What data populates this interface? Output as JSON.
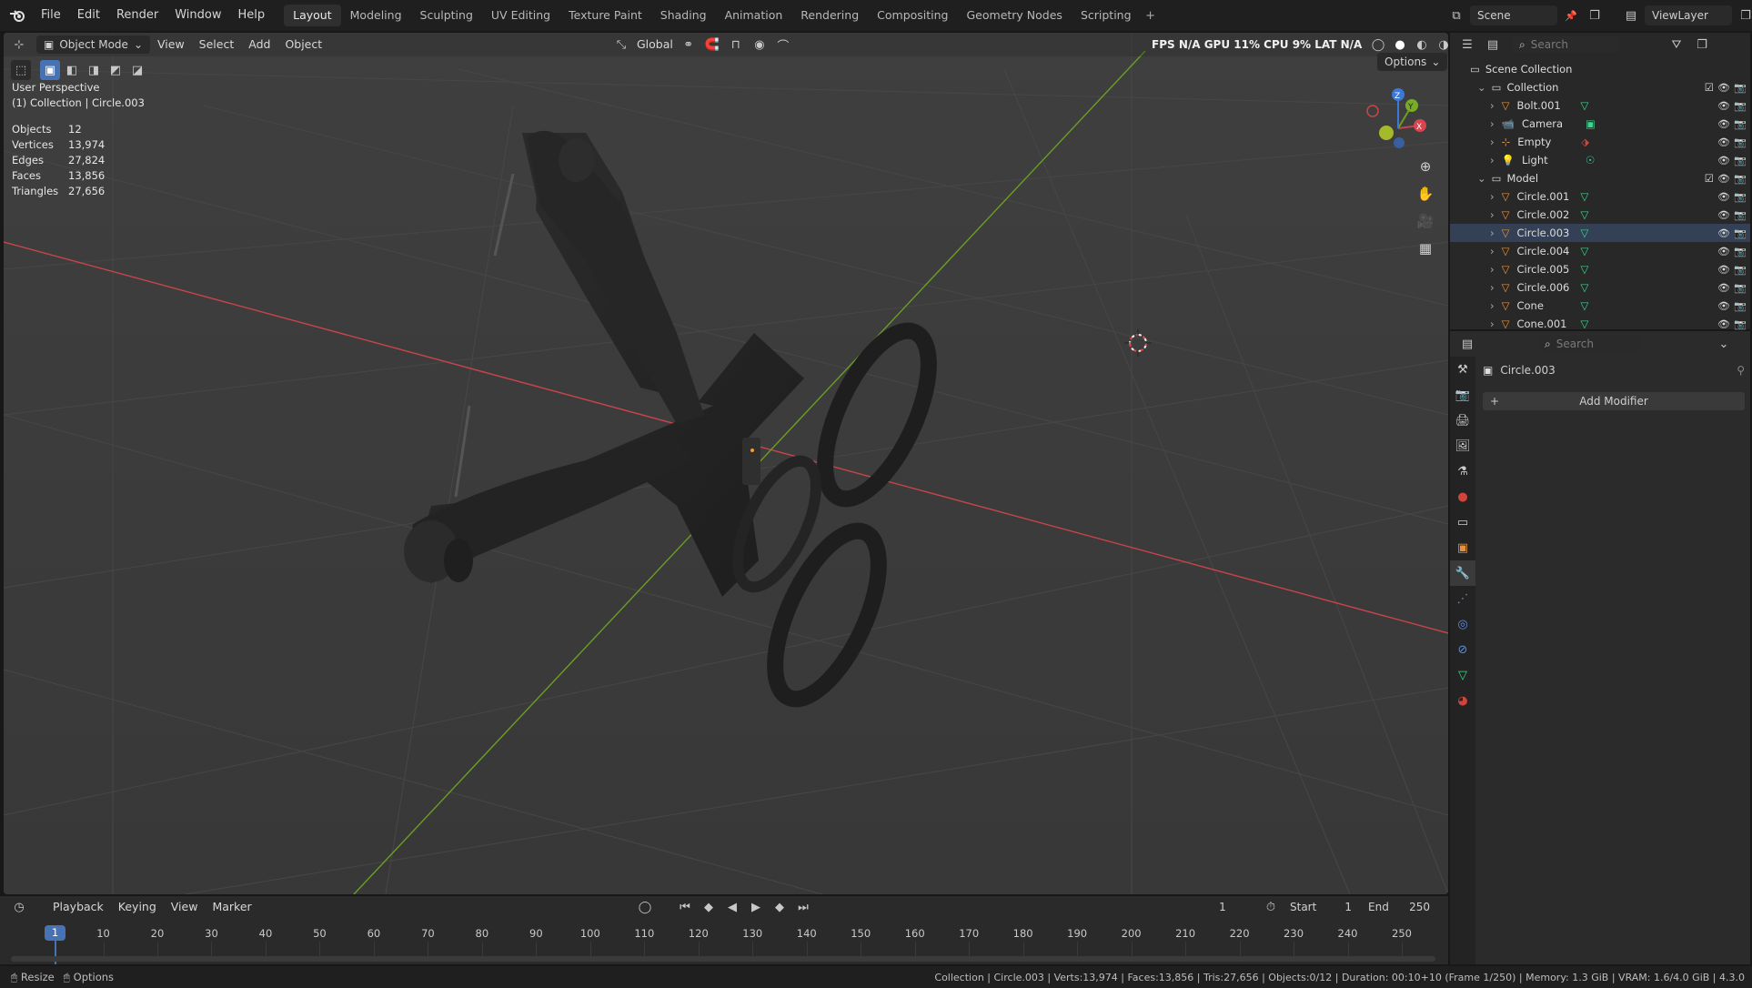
{
  "menu": [
    "File",
    "Edit",
    "Render",
    "Window",
    "Help"
  ],
  "workspaces": [
    "Layout",
    "Modeling",
    "Sculpting",
    "UV Editing",
    "Texture Paint",
    "Shading",
    "Animation",
    "Rendering",
    "Compositing",
    "Geometry Nodes",
    "Scripting"
  ],
  "active_workspace": "Layout",
  "scene_name": "Scene",
  "view_layer": "ViewLayer",
  "viewport_header": {
    "mode": "Object Mode",
    "menus": [
      "View",
      "Select",
      "Add",
      "Object"
    ],
    "orientation": "Global",
    "perf_overlay": "FPS  N/A  GPU  11%  CPU  9%  LAT  N/A",
    "options": "Options"
  },
  "viewport_info": {
    "view_name": "User Perspective",
    "context": "(1) Collection | Circle.003",
    "stats": [
      {
        "label": "Objects",
        "value": "12"
      },
      {
        "label": "Vertices",
        "value": "13,974"
      },
      {
        "label": "Edges",
        "value": "27,824"
      },
      {
        "label": "Faces",
        "value": "13,856"
      },
      {
        "label": "Triangles",
        "value": "27,656"
      }
    ]
  },
  "outliner": {
    "search_placeholder": "Search",
    "root": "Scene Collection",
    "collections": [
      {
        "name": "Collection",
        "items": [
          {
            "name": "Bolt.001",
            "icon": "mesh"
          },
          {
            "name": "Camera",
            "icon": "camera"
          },
          {
            "name": "Empty",
            "icon": "empty"
          },
          {
            "name": "Light",
            "icon": "light"
          }
        ]
      },
      {
        "name": "Model",
        "items": [
          {
            "name": "Circle.001",
            "icon": "mesh"
          },
          {
            "name": "Circle.002",
            "icon": "mesh"
          },
          {
            "name": "Circle.003",
            "icon": "mesh",
            "selected": true
          },
          {
            "name": "Circle.004",
            "icon": "mesh"
          },
          {
            "name": "Circle.005",
            "icon": "mesh"
          },
          {
            "name": "Circle.006",
            "icon": "mesh"
          },
          {
            "name": "Cone",
            "icon": "mesh"
          },
          {
            "name": "Cone.001",
            "icon": "mesh"
          }
        ]
      }
    ]
  },
  "properties": {
    "search_placeholder": "Search",
    "object_name": "Circle.003",
    "add_modifier": "Add Modifier"
  },
  "timeline": {
    "menus": [
      "Playback",
      "Keying",
      "View",
      "Marker"
    ],
    "current_frame": "1",
    "start_label": "Start",
    "start": "1",
    "end_label": "End",
    "end": "250",
    "ticks": [
      "1",
      "10",
      "20",
      "30",
      "40",
      "50",
      "60",
      "70",
      "80",
      "90",
      "100",
      "110",
      "120",
      "130",
      "140",
      "150",
      "160",
      "170",
      "180",
      "190",
      "200",
      "210",
      "220",
      "230",
      "240",
      "250"
    ]
  },
  "statusbar": {
    "left1": "Resize",
    "left2": "Options",
    "right": "Collection | Circle.003 | Verts:13,974 | Faces:13,856 | Tris:27,656 | Objects:0/12 | Duration: 00:10+10 (Frame 1/250) | Memory: 1.3 GiB | VRAM: 1.6/4.0 GiB | 4.3.0"
  },
  "colors": {
    "accent": "#4772b3",
    "selection": "#344056",
    "mesh_icon": "#e6913a",
    "data_icon": "#3fd38f",
    "x_axis": "#d9454e",
    "y_axis": "#6b9e22"
  }
}
